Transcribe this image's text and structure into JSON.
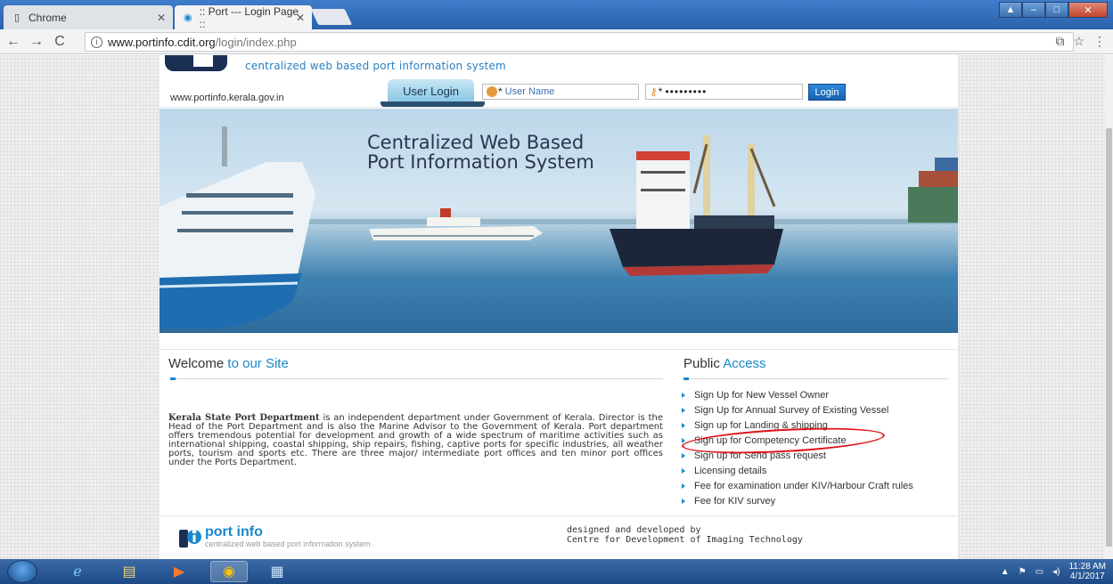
{
  "browser": {
    "tabs": [
      {
        "label": "Chrome",
        "active": false
      },
      {
        "label": ":: Port --- Login Page ::",
        "active": true
      }
    ],
    "url_host": "www.portinfo.cdit.org",
    "url_path": "/login/index.php"
  },
  "site": {
    "tagline": "centralized web based port information system",
    "gov_link": "www.portinfo.kerala.gov.in",
    "login": {
      "tab_label": "User Login",
      "username_placeholder": "User Name",
      "password_value": "•••••••••",
      "login_button": "Login"
    },
    "banner": {
      "line1": "Centralized Web Based",
      "line2": "Port Information System"
    },
    "welcome": {
      "title_plain": "Welcome",
      "title_accent": "to our Site",
      "bold_lead": "Kerala State Port Department",
      "body": " is an independent department under Government of Kerala. Director is the Head of the Port Department and is also the Marine Advisor to the Government of Kerala. Port department offers tremendous potential for development and growth of a wide spectrum of maritime activities such as international shipping, coastal shipping, ship repairs, fishing, captive ports for specific industries, all weather ports, tourism and sports etc. There are three major/ intermediate port offices and ten minor port offices under the Ports Department."
    },
    "public_access": {
      "title_plain": "Public",
      "title_accent": "Access",
      "items": [
        "Sign Up for New Vessel Owner",
        "Sign Up for Annual Survey of Existing Vessel",
        "Sign up for Landing & shipping",
        "Sign up for Competency Certificate",
        "Sign up for Send pass request",
        "Licensing details",
        "Fee for examination under KIV/Harbour Craft rules",
        "Fee for KIV survey"
      ],
      "highlight_color": "#e0121b"
    },
    "footer": {
      "brand": "port info",
      "brand_sub": "centralized web based port information system",
      "credit_line1": "designed and developed by",
      "credit_line2": "Centre for Development of Imaging Technology"
    },
    "accent_color": "#1a88c9"
  },
  "taskbar": {
    "time": "11:28 AM",
    "date": "4/1/2017"
  }
}
